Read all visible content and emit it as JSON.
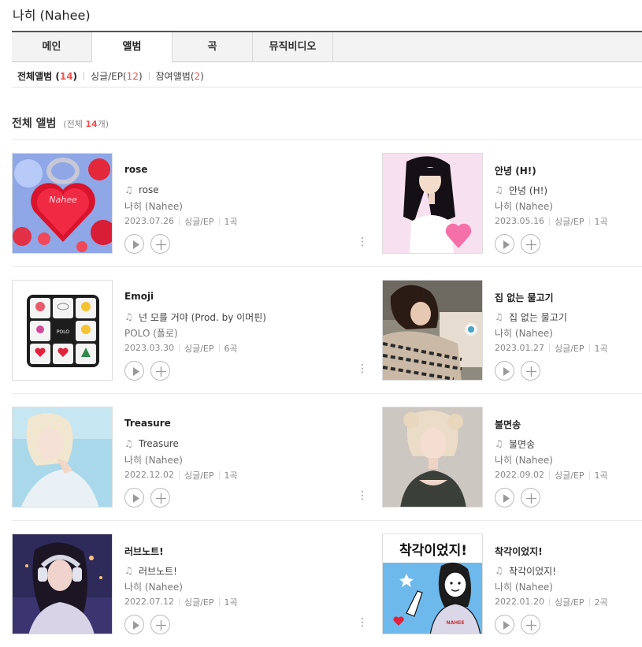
{
  "artist": {
    "name": "나히 (Nahee)"
  },
  "tabs": [
    {
      "label": "메인"
    },
    {
      "label": "앨범"
    },
    {
      "label": "곡"
    },
    {
      "label": "뮤직비디오"
    }
  ],
  "filters": {
    "all_label": "전체앨범",
    "all_count": "14",
    "single_label": "싱글/EP",
    "single_count": "12",
    "feat_label": "참여앨범",
    "feat_count": "2"
  },
  "section": {
    "title": "전체 앨범",
    "sub_prefix": "(전체 ",
    "sub_count": "14",
    "sub_suffix": "개)"
  },
  "albums": [
    {
      "title": "rose",
      "track": "rose",
      "artist": "나히 (Nahee)",
      "date": "2023.07.26",
      "type": "싱글/EP",
      "count": "1곡"
    },
    {
      "title": "안녕 (H!)",
      "track": "안녕 (H!)",
      "artist": "나히 (Nahee)",
      "date": "2023.05.16",
      "type": "싱글/EP",
      "count": "1곡"
    },
    {
      "title": "Emoji",
      "track": "넌 모를 거야 (Prod. by 이머핀)",
      "artist": "POLO (폴로)",
      "date": "2023.03.30",
      "type": "싱글/EP",
      "count": "6곡"
    },
    {
      "title": "집 없는 물고기",
      "track": "집 없는 물고기",
      "artist": "나히 (Nahee)",
      "date": "2023.01.27",
      "type": "싱글/EP",
      "count": "1곡"
    },
    {
      "title": "Treasure",
      "track": "Treasure",
      "artist": "나히 (Nahee)",
      "date": "2022.12.02",
      "type": "싱글/EP",
      "count": "1곡"
    },
    {
      "title": "불면송",
      "track": "불면송",
      "artist": "나히 (Nahee)",
      "date": "2022.09.02",
      "type": "싱글/EP",
      "count": "1곡"
    },
    {
      "title": "러브노트!",
      "track": "러브노트!",
      "artist": "나히 (Nahee)",
      "date": "2022.07.12",
      "type": "싱글/EP",
      "count": "1곡"
    },
    {
      "title": "착각이었지!",
      "track": "착각이었지!",
      "artist": "나히 (Nahee)",
      "date": "2022.01.20",
      "type": "싱글/EP",
      "count": "2곡"
    }
  ],
  "cover_art": {
    "emoji_center_label": "POLO",
    "emoji_top_text": "Nahee",
    "comic_text": "착각이었지!",
    "comic_shirt": "NAHEE"
  },
  "icons": {
    "note": "music-note-icon",
    "play": "play-icon",
    "add": "plus-icon",
    "more": "more-vertical-icon"
  },
  "colors": {
    "accent": "#f0544f",
    "tab_active_border": "#555555"
  }
}
